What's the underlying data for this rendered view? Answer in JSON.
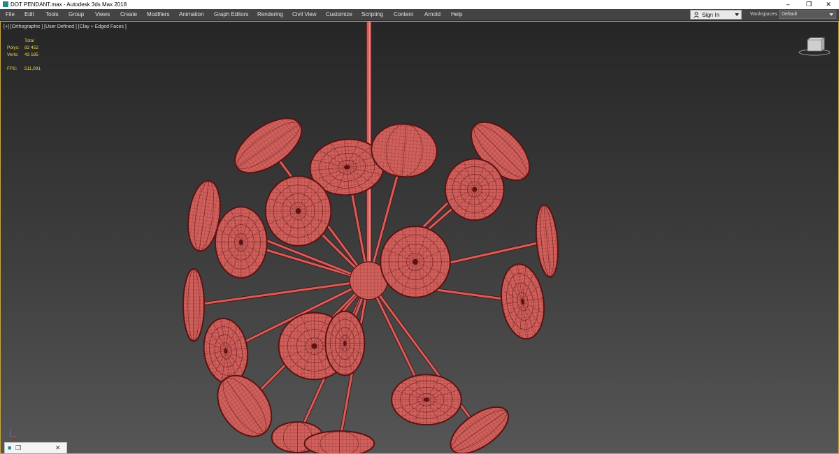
{
  "window": {
    "title": "DOT PENDANT.max - Autodesk 3ds Max 2018",
    "minimize_glyph": "–",
    "restore_glyph": "❐",
    "close_glyph": "✕"
  },
  "menu": {
    "items": [
      "File",
      "Edit",
      "Tools",
      "Group",
      "Views",
      "Create",
      "Modifiers",
      "Animation",
      "Graph Editors",
      "Rendering",
      "Civil View",
      "Customize",
      "Scripting",
      "Content",
      "Arnold",
      "Help"
    ]
  },
  "signin": {
    "label": "Sign In"
  },
  "workspaces": {
    "label": "Workspaces:",
    "value": "Default"
  },
  "viewport": {
    "label": "[+] [Orthographic ] [User Defined ] [Clay + Edged Faces ]",
    "stats": {
      "header": "Total",
      "polys_label": "Polys:",
      "polys_value": "82 452",
      "verts_label": "Verts:",
      "verts_value": "43 185",
      "fps_label": "FPS:",
      "fps_value": "511,091"
    }
  },
  "colors": {
    "mesh_fill": "#d0605c",
    "mesh_edge": "#5a1212",
    "stats_text": "#e7d84a",
    "viewport_border": "#c8a93b"
  },
  "minipanel": {
    "restore_glyph": "❐",
    "close_glyph": "✕"
  },
  "icons": [
    "app-icon",
    "user-icon",
    "viewcube-icon",
    "axis-tripod-icon"
  ]
}
